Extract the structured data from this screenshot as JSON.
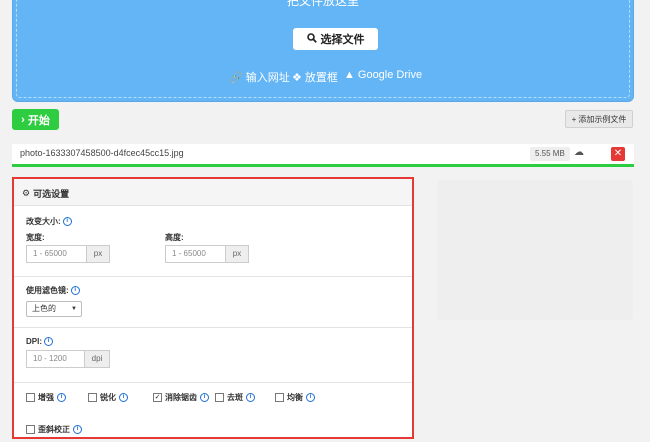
{
  "dropzone": {
    "hint": "把文件放这里",
    "choose_button": "选择文件",
    "sources": [
      {
        "icon": "link-icon",
        "label": "输入网址"
      },
      {
        "icon": "dropbox-icon",
        "label": "放置框"
      },
      {
        "icon": "google-drive-icon",
        "label": "Google Drive"
      }
    ]
  },
  "toolbar": {
    "start_label": "开始",
    "sample_label": "添加示例文件"
  },
  "file": {
    "name": "photo-1633307458500-d4fcec45cc15.jpg",
    "size": "5.55 MB"
  },
  "options": {
    "title": "可选设置",
    "resize": {
      "label": "改变大小:",
      "width_label": "宽度:",
      "width_placeholder": "1 - 65000",
      "height_label": "高度:",
      "height_placeholder": "1 - 65000",
      "unit": "px"
    },
    "filter": {
      "label": "使用滤色镜:",
      "selected": "上色的"
    },
    "dpi": {
      "label": "DPI:",
      "placeholder": "10 - 1200",
      "unit": "dpi"
    },
    "checkboxes": [
      {
        "label": "增强",
        "checked": false
      },
      {
        "label": "锐化",
        "checked": false
      },
      {
        "label": "消除锯齿",
        "checked": true
      },
      {
        "label": "去斑",
        "checked": false
      },
      {
        "label": "均衡",
        "checked": false
      }
    ],
    "deskew": {
      "label": "歪斜校正",
      "checked": false
    }
  },
  "colors": {
    "accent_blue": "#64b5f6",
    "start_green": "#2ecc40",
    "highlight_red": "#e53935"
  }
}
